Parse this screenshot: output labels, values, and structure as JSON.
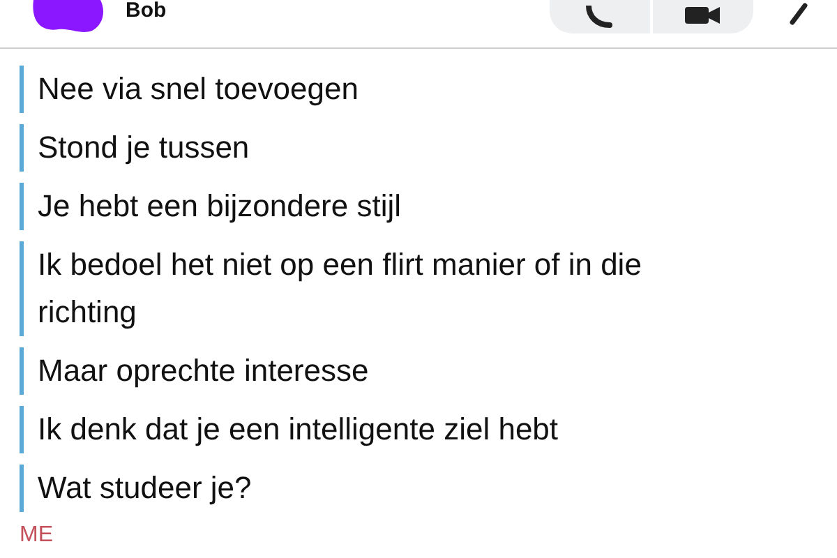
{
  "header": {
    "name": "Bob"
  },
  "messages": [
    {
      "text": "Nee via snel toevoegen"
    },
    {
      "text": "Stond je tussen"
    },
    {
      "text": "Je hebt een bijzondere stijl"
    },
    {
      "text": "Ik bedoel het niet op een flirt manier of in die richting"
    },
    {
      "text": "Maar oprechte interesse"
    },
    {
      "text": "Ik denk dat je een intelligente ziel hebt"
    },
    {
      "text": "Wat studeer je?"
    }
  ],
  "next_sender": "ME"
}
